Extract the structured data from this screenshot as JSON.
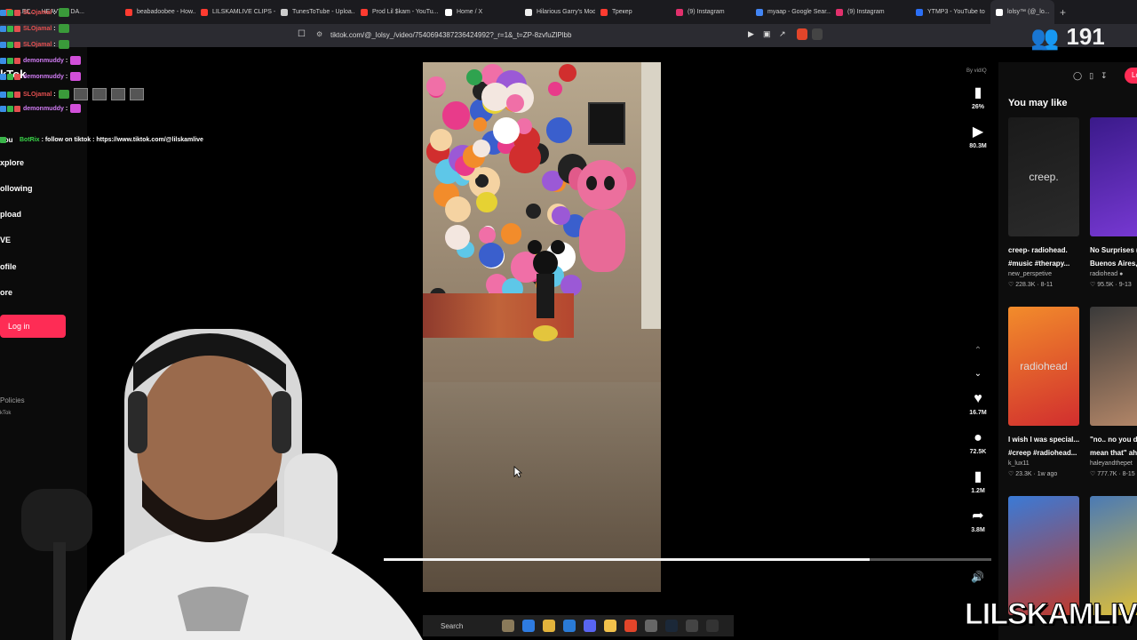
{
  "browser": {
    "tabs": [
      {
        "label": "...EC... - HEAVY ft. DA...",
        "color": "#ff3b30"
      },
      {
        "label": "beabadoobee - How...",
        "color": "#ff3b30"
      },
      {
        "label": "LILSKAMLIVE CLIPS -",
        "color": "#ff3b30"
      },
      {
        "label": "TunesToTube - Uploa...",
        "color": "#cccccc"
      },
      {
        "label": "Prod Lil $kam - YouTu...",
        "color": "#ff3b30"
      },
      {
        "label": "Home / X",
        "color": "#ffffff"
      },
      {
        "label": "Hilarious Garry's Mod",
        "color": "#eeeeee"
      },
      {
        "label": "Трекер",
        "color": "#ff3b30"
      },
      {
        "label": "(9) Instagram",
        "color": "#e1306c"
      },
      {
        "label": "myaap - Google Sear...",
        "color": "#4285f4"
      },
      {
        "label": "(9) Instagram",
        "color": "#e1306c"
      },
      {
        "label": "YTMP3 - YouTube to",
        "color": "#2b6ff6"
      },
      {
        "label": "lolsy™ (@_lo...",
        "color": "#ffffff"
      }
    ],
    "url": "tiktok.com/@_lolsy_/video/7540694387236424992?_r=1&_t=ZP-8zvfuZlPlbb"
  },
  "stream": {
    "viewer_count": "191",
    "watermark": "LILSKAMLIVE"
  },
  "chat": {
    "lines": [
      {
        "user": "SLOjamal",
        "text": ":",
        "color": "#e34f4f"
      },
      {
        "user": "SLOjamal",
        "text": ":",
        "color": "#e34f4f"
      },
      {
        "user": "SLOjamal",
        "text": ":",
        "color": "#e34f4f"
      },
      {
        "user": "demonmuddy",
        "text": ":",
        "color": "#d27df5"
      },
      {
        "user": "demonmuddy",
        "text": ":",
        "color": "#d27df5"
      },
      {
        "user": "SLOjamal",
        "text": ":",
        "color": "#e34f4f"
      },
      {
        "user": "demonmuddy",
        "text": ":",
        "color": "#d27df5"
      }
    ],
    "bot": {
      "user": "BotRix",
      "text": ": follow on tiktok : https://www.tiktok.com/@lilskamlive"
    }
  },
  "tiktok": {
    "brand": "kTok",
    "you_label": "You",
    "nav": [
      "xplore",
      "ollowing",
      "pload",
      "VE",
      "ofile",
      "ore"
    ],
    "login_label": "Log in",
    "policies": "Policies",
    "copyright": "kTok",
    "login_pill": "Lo",
    "by_vidiq": "By vidIQ",
    "rail": {
      "stat_pct": "26%",
      "plays": "80.3M",
      "likes": "16.7M",
      "comments": "72.5K",
      "saves": "1.2M",
      "shares": "3.8M"
    },
    "progress": 0.8,
    "you_may_like": "You may like",
    "cards": [
      {
        "title": "creep- radiohead.",
        "title2": "#music #therapy...",
        "author": "new_perspetive",
        "stats": "♡ 228.3K · 8-11",
        "thumb_text": "creep."
      },
      {
        "title": "No Surprises (",
        "title2": "Buenos Aires, ...",
        "author": "radiohead ●",
        "stats": "♡ 95.5K · 9-13",
        "thumb_text": ""
      },
      {
        "title": "I wish I was special...",
        "title2": "#creep #radiohead...",
        "author": "k_lux11",
        "stats": "♡ 23.3K · 1w ago",
        "thumb_text": "radiohead"
      },
      {
        "title": "\"no.. no you d",
        "title2": "mean that\" ah",
        "author": "haleyandthepet",
        "stats": "♡ 777.7K · 8-15",
        "thumb_text": ""
      },
      {
        "title": "",
        "title2": "",
        "author": "",
        "stats": "",
        "thumb_text": ""
      },
      {
        "title": "",
        "title2": "",
        "author": "",
        "stats": "",
        "thumb_text": ""
      }
    ]
  },
  "taskbar": {
    "search_label": "Search"
  },
  "colors": {
    "tiktok_red": "#fe2c55",
    "bg": "#000000",
    "sidebar": "#0b0b0b"
  }
}
